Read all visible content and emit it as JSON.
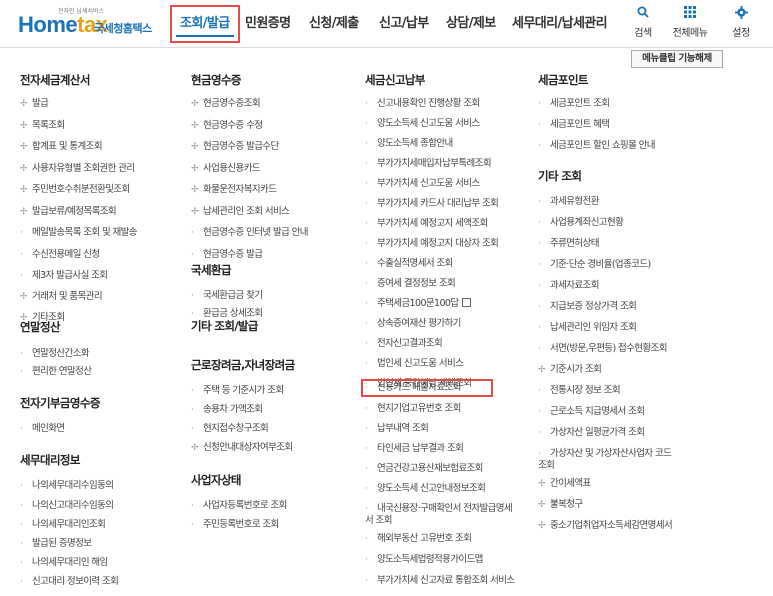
{
  "header": {
    "logo_small": "전자민 납세서비스",
    "logo_home": "Home",
    "logo_tax": "tax",
    "logo_sub": "국세청홈택스",
    "nav": [
      "조회/발급",
      "민원증명",
      "신청/제출",
      "신고/납부",
      "상담/제보",
      "세무대리/납세관리"
    ],
    "tools": [
      {
        "icon": "search-icon",
        "label": "검색"
      },
      {
        "icon": "grid-menu-icon",
        "label": "전체메뉴"
      },
      {
        "icon": "gear-icon",
        "label": "설정"
      }
    ]
  },
  "unpin_label": "메뉴클립 기능해제",
  "col1": {
    "s1": {
      "title": "전자세금계산서",
      "items": [
        "발급",
        "목록조회",
        "합계표 및 통계조회",
        "사용자유형별 조회권한 관리",
        "주민번호수취분전환및조회",
        "발급보류/예정목록조회",
        "메일발송목록 조회 및 재발송",
        "수신전용메일 신청",
        "제3자 발급사실 조회",
        "거래처 및 품목관리",
        "기타조회"
      ]
    },
    "s2": {
      "title": "연말정산",
      "items": [
        "연말정산간소화",
        "편리한 연말정산"
      ]
    },
    "s3": {
      "title": "전자기부금영수증",
      "items": [
        "메인화면"
      ]
    },
    "s4": {
      "title": "세무대리정보",
      "items": [
        "나의세무대리수임동의",
        "나의신고대리수임동의",
        "나의세무대리인조회",
        "발급된 증명정보",
        "나의세무대리인 해임",
        "신고대리 정보이력 조회"
      ]
    }
  },
  "col2": {
    "s1": {
      "title": "현금영수증",
      "items": [
        "현금영수증조회",
        "현금영수증 수정",
        "현금영수증 발급수단",
        "사업용신용카드",
        "화물운전자복지카드",
        "납세관리인 조회 서비스",
        "현금영수증 인터넷 발급 안내",
        "현금영수증 발급"
      ]
    },
    "s2": {
      "title": "국세환급",
      "items": [
        "국세환급금 찾기",
        "환급금 상세조회"
      ]
    },
    "s2b": {
      "title": "기타 조회/발급"
    },
    "s3": {
      "title": "근로장려금,자녀장려금",
      "items": [
        "주택 등 기준시가 조회",
        "송용차 가액조회",
        "현지접수창구조회",
        "신청안내대상자여부조회"
      ]
    },
    "s4": {
      "title": "사업자상태",
      "items": [
        "사업자등록번호로 조회",
        "주민등록번호로 조회"
      ]
    }
  },
  "col3": {
    "s1": {
      "title": "세금신고납부",
      "items": [
        "신고내용확인 진행상황 조회",
        "양도소득세 신고도움 서비스",
        "양도소득세 종합안내",
        "부가가치세매입자납부특례조회",
        "부가가치세 신고도움 서비스",
        "부가가치세 카드사 대리납부 조회",
        "부가가치세 예정고지 세액조회",
        "부가가치세 예정고지 대상자 조회",
        "수출실적명세서 조회",
        "증여세 결정정보 조회",
        "주택세금100문100답",
        "상속증여재산 평가하기",
        "전자신고결과조회",
        "법인세 신고도움 서비스",
        "법인세 중간예납 세액조회",
        "신용카드 매출자료조회",
        "현지기업고유번호 조회",
        "납부내역 조회",
        "타인세금 납부결과 조회",
        "연금건강고용산재보험료조회",
        "양도소득세 신고안내정보조회",
        "내국신용장·구매확인서 전자발급명세서 조회",
        "해외부동산 고유번호 조회",
        "양도소득세법령적용가이드맵",
        "부가가치세 신고자료 통합조회 서비스"
      ]
    }
  },
  "col4": {
    "s1": {
      "title": "세금포인트",
      "items": [
        "세금포인트 조회",
        "세금포인트 혜택",
        "세금포인트 할인 쇼핑몰 안내"
      ]
    },
    "s2": {
      "title": "기타 조회",
      "items": [
        "과세유형전환",
        "사업용계좌신고현황",
        "주류면허상태",
        "기준·단순 경비율(업종코드)",
        "과세자료조회",
        "지급보증 정상가격 조회",
        "납세관리인 위임자 조회",
        "서면(방문,우편등) 접수현황조회",
        "기준시가 조회",
        "전통시장 정보 조회",
        "근로소득 지급명세서 조회",
        "가상자산 일평균가격 조회",
        "가상자산 및 가상자산사업자 코드 조회",
        "간이세액표",
        "불복청구",
        "중소기업취업자소득세감면명세서"
      ]
    }
  }
}
